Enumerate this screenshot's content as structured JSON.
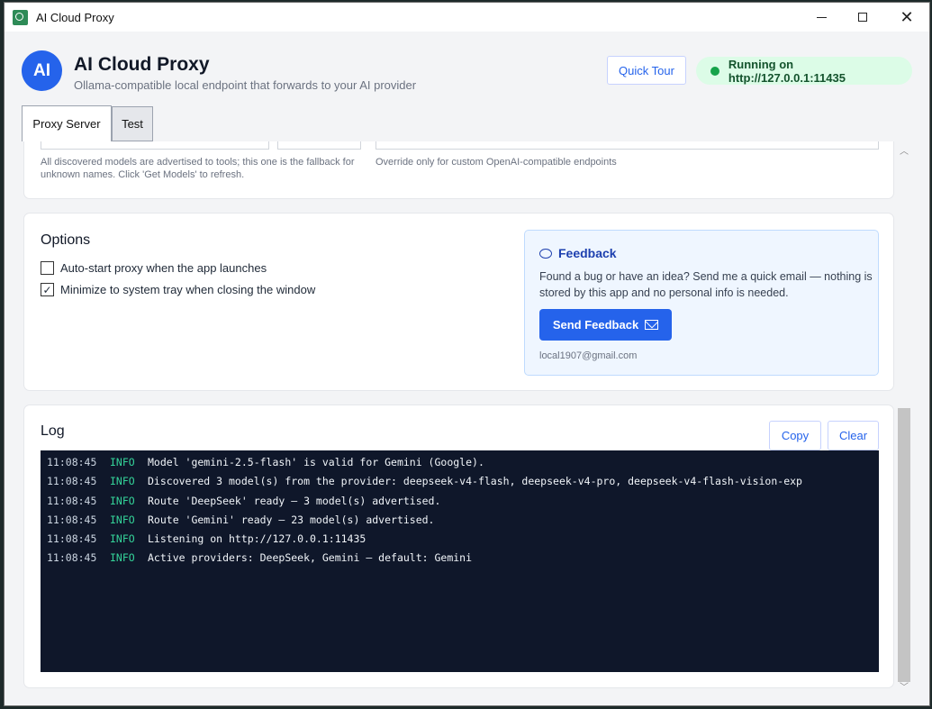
{
  "window": {
    "title": "AI Cloud Proxy"
  },
  "header": {
    "avatar": "AI",
    "title": "AI Cloud Proxy",
    "subtitle": "Ollama-compatible local endpoint that forwards to your AI provider",
    "quick_tour": "Quick Tour",
    "status": "Running on http://127.0.0.1:11435",
    "status_color": "#16a34a"
  },
  "tabs": [
    {
      "label": "Proxy Server",
      "active": true
    },
    {
      "label": "Test",
      "active": false
    }
  ],
  "model_section": {
    "model_hint": "All discovered models are advertised to tools; this one is the fallback for unknown names. Click 'Get Models' to refresh.",
    "endpoint_hint": "Override only for custom OpenAI-compatible endpoints"
  },
  "options": {
    "title": "Options",
    "items": [
      {
        "label": "Auto-start proxy when the app launches",
        "checked": false
      },
      {
        "label": "Minimize to system tray when closing the window",
        "checked": true
      }
    ]
  },
  "feedback": {
    "title": "Feedback",
    "text": "Found a bug or have an idea? Send me a quick email — nothing is stored by this app and no personal info is needed.",
    "button": "Send Feedback",
    "email": "local1907@gmail.com"
  },
  "log": {
    "title": "Log",
    "copy": "Copy",
    "clear": "Clear",
    "lines": [
      {
        "time": "11:08:45",
        "level": "INFO",
        "msg": "Model 'gemini-2.5-flash' is valid for Gemini (Google)."
      },
      {
        "time": "11:08:45",
        "level": "INFO",
        "msg": "Discovered 3 model(s) from the provider: deepseek-v4-flash, deepseek-v4-pro, deepseek-v4-flash-vision-exp"
      },
      {
        "time": "11:08:45",
        "level": "INFO",
        "msg": "Route 'DeepSeek' ready — 3 model(s) advertised."
      },
      {
        "time": "11:08:45",
        "level": "INFO",
        "msg": "Route 'Gemini' ready — 23 model(s) advertised."
      },
      {
        "time": "11:08:45",
        "level": "INFO",
        "msg": "Listening on http://127.0.0.1:11435"
      },
      {
        "time": "11:08:45",
        "level": "INFO",
        "msg": "Active providers: DeepSeek, Gemini — default: Gemini"
      }
    ]
  }
}
